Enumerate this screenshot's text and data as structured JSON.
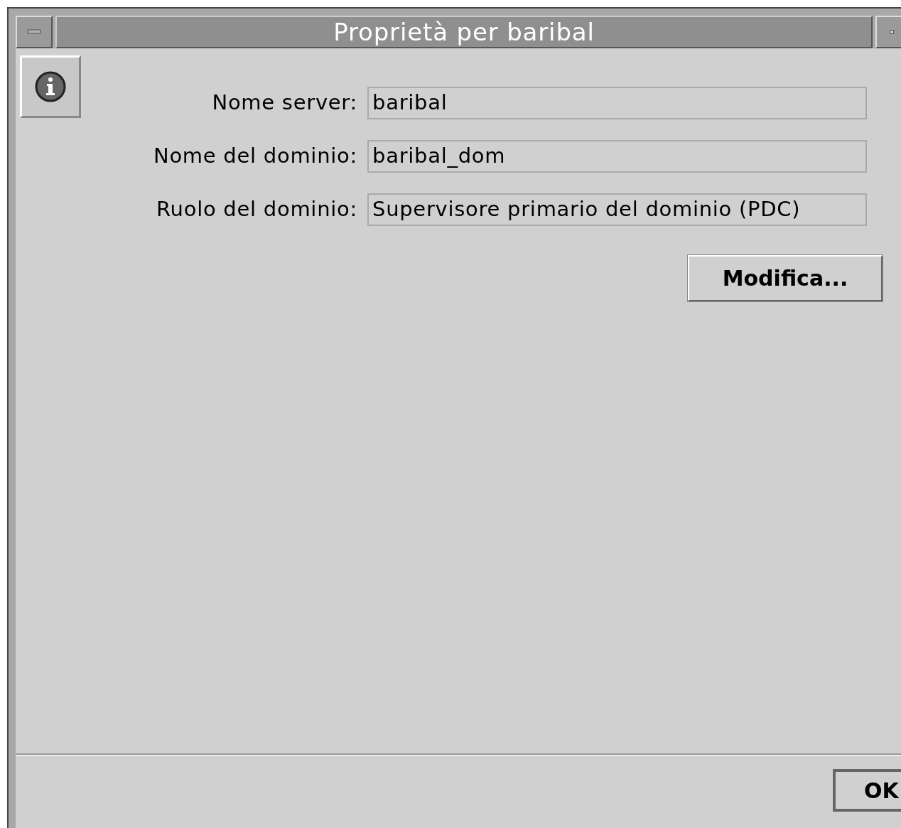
{
  "window": {
    "title": "Proprietà per baribal"
  },
  "fields": [
    {
      "label": "Nome server:",
      "value": "baribal"
    },
    {
      "label": "Nome del dominio:",
      "value": "baribal_dom"
    },
    {
      "label": "Ruolo del dominio:",
      "value": "Supervisore primario del dominio (PDC)"
    }
  ],
  "edit_button": "Modifica...",
  "ok_button": "OK"
}
